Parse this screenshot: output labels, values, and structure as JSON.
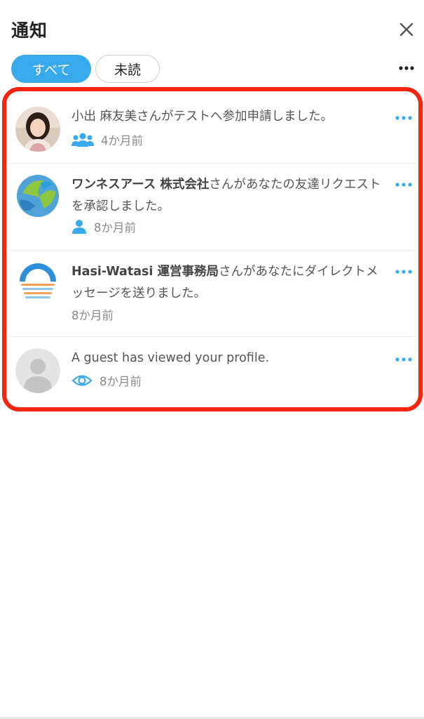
{
  "header": {
    "title": "通知",
    "close_icon": "close-icon"
  },
  "tabs": [
    {
      "label": "すべて",
      "active": true
    },
    {
      "label": "未読",
      "active": false
    }
  ],
  "menu_icon": "more-horizontal-icon",
  "colors": {
    "accent": "#38a9ec",
    "highlight": "#f5250f",
    "text": "#555555",
    "muted": "#8a8a8a"
  },
  "notifications": [
    {
      "name": "",
      "message": "小出 麻友美さんがテストへ参加申請しました。",
      "icon": "group-icon",
      "time": "4か月前"
    },
    {
      "name": "ワンネスアース 株式会社",
      "message": "さんがあなたの友達リクエストを承認しました。",
      "icon": "person-icon",
      "time": "8か月前"
    },
    {
      "name": "Hasi-Watasi 運営事務局",
      "message": "さんがあなたにダイレクトメッセージを送りました。",
      "icon": "",
      "time": "8か月前"
    },
    {
      "name": "",
      "message": "A guest has viewed your profile.",
      "icon": "eye-icon",
      "time": "8か月前"
    }
  ]
}
